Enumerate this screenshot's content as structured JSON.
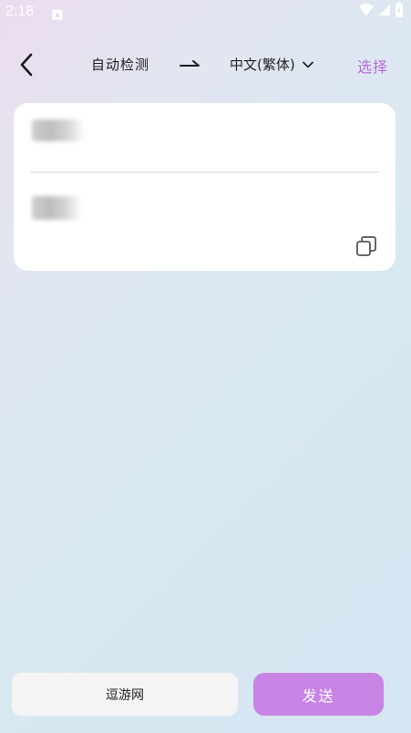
{
  "status_bar": {
    "time": "2:18",
    "app_icon": "notification-app-icon",
    "icons": [
      "wifi-icon",
      "signal-icon",
      "battery-icon"
    ]
  },
  "header": {
    "back_icon": "back-chevron-icon",
    "source_language": "自动检测",
    "arrow_icon": "right-arrow-icon",
    "target_language": "中文(繁体)",
    "dropdown_icon": "chevron-down-icon",
    "select_label": "选择"
  },
  "translation_card": {
    "source_text_redacted": true,
    "translated_text_redacted": true,
    "copy_icon": "copy-icon"
  },
  "bottom_bar": {
    "input_value": "逗游网",
    "send_label": "发送"
  },
  "colors": {
    "accent": "#c884e4",
    "select_link": "#b96bd6",
    "card_background": "#ffffff",
    "input_background": "#f4f4f4"
  }
}
